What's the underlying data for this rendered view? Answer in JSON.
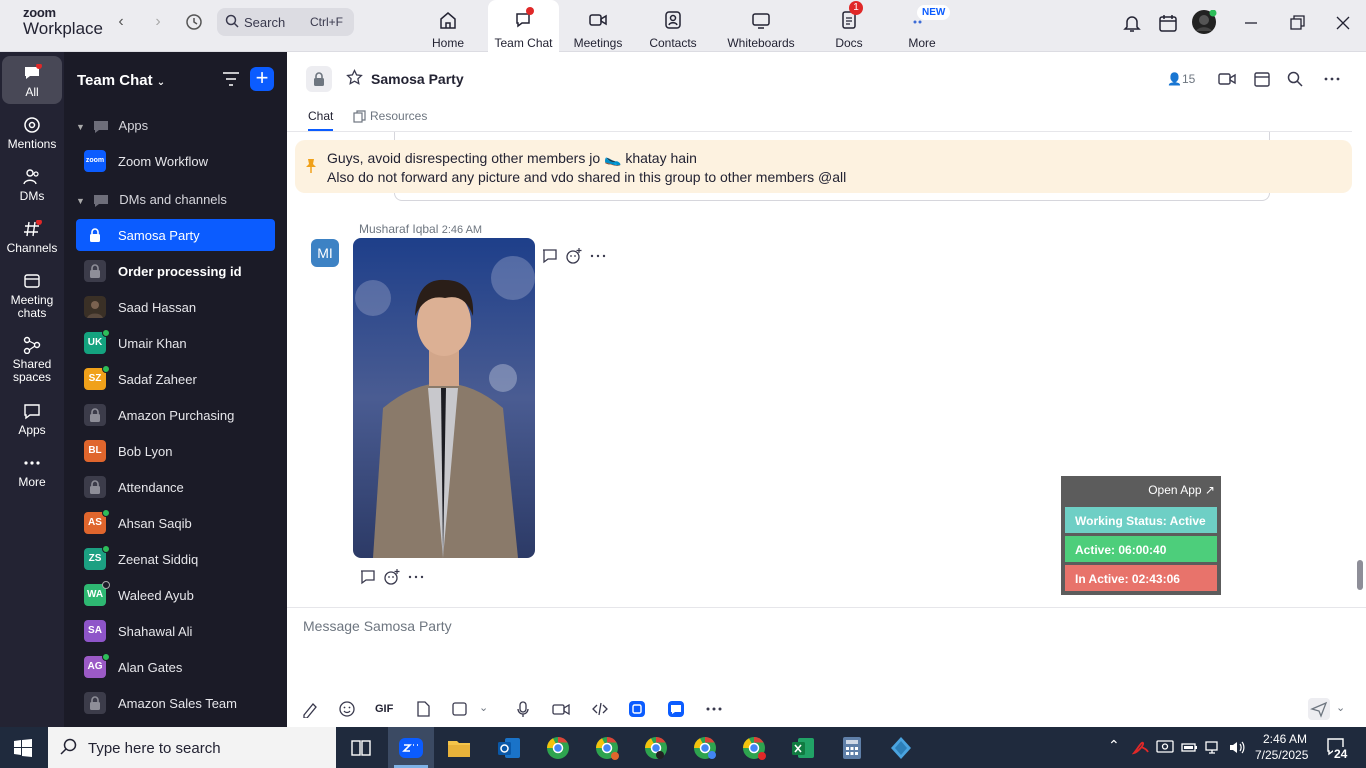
{
  "brand": {
    "line1": "zoom",
    "line2": "Workplace"
  },
  "search": {
    "label": "Search",
    "shortcut": "Ctrl+F"
  },
  "nav_tabs": [
    {
      "label": "Home",
      "icon": "home-icon"
    },
    {
      "label": "Team Chat",
      "icon": "chat-icon"
    },
    {
      "label": "Meetings",
      "icon": "video-icon"
    },
    {
      "label": "Contacts",
      "icon": "contacts-icon"
    },
    {
      "label": "Whiteboards",
      "icon": "whiteboard-icon"
    },
    {
      "label": "Docs",
      "icon": "docs-icon",
      "badge": "1"
    },
    {
      "label": "More",
      "icon": "more-icon",
      "badge": "NEW"
    }
  ],
  "rail": [
    {
      "label": "All"
    },
    {
      "label": "Mentions"
    },
    {
      "label": "DMs"
    },
    {
      "label": "Channels"
    },
    {
      "label": "Meeting",
      "label2": "chats"
    },
    {
      "label": "Shared",
      "label2": "spaces"
    },
    {
      "label": "Apps"
    },
    {
      "label": "More"
    }
  ],
  "sidebar": {
    "title": "Team Chat",
    "sections": [
      "Apps",
      "DMs and channels"
    ],
    "app_item": {
      "label": "Zoom Workflow",
      "avatar": "zoom"
    },
    "items": [
      {
        "label": "Samosa Party",
        "type": "lock"
      },
      {
        "label": "Order processing id",
        "type": "lock"
      },
      {
        "label": "Saad Hassan",
        "type": "photo"
      },
      {
        "label": "Umair Khan",
        "initials": "UK",
        "color": "#14a37f"
      },
      {
        "label": "Sadaf Zaheer",
        "initials": "SZ",
        "color": "#f0a11a"
      },
      {
        "label": "Amazon Purchasing",
        "type": "lock"
      },
      {
        "label": "Bob Lyon",
        "initials": "BL",
        "color": "#e0662d"
      },
      {
        "label": "Attendance",
        "type": "lock"
      },
      {
        "label": "Ahsan Saqib",
        "initials": "AS",
        "color": "#e0662d"
      },
      {
        "label": "Zeenat Siddiq",
        "initials": "ZS",
        "color": "#1ca082"
      },
      {
        "label": "Waleed Ayub",
        "initials": "WA",
        "color": "#2eb872"
      },
      {
        "label": "Shahawal Ali",
        "initials": "SA",
        "color": "#8e55c9"
      },
      {
        "label": "Alan Gates",
        "initials": "AG",
        "color": "#9b5ac6"
      },
      {
        "label": "Amazon Sales Team",
        "type": "lock"
      }
    ]
  },
  "channel": {
    "title": "Samosa Party",
    "members": "15",
    "tabs": [
      "Chat",
      "Resources"
    ]
  },
  "pinned": {
    "line1": "Guys, avoid disrespecting other members jo 🥿 khatay hain",
    "line2": "Also do not forward any picture and vdo shared in this group to other members @all"
  },
  "message": {
    "avatar": "MI",
    "sender": "Musharaf Iqbal",
    "time": "2:46 AM"
  },
  "extension": {
    "open": "Open App ↗",
    "status": "Working Status: Active",
    "active": "Active: 06:00:40",
    "inactive": "In Active: 02:43:06"
  },
  "composer": {
    "placeholder": "Message Samosa Party",
    "gif": "GIF"
  },
  "taskbar": {
    "search": "Type here to search",
    "time": "2:46 AM",
    "date": "7/25/2025",
    "notifications": "24"
  },
  "colors": {
    "accent": "#0b5cff",
    "sidebar": "#1b1b27",
    "rail": "#232333"
  }
}
